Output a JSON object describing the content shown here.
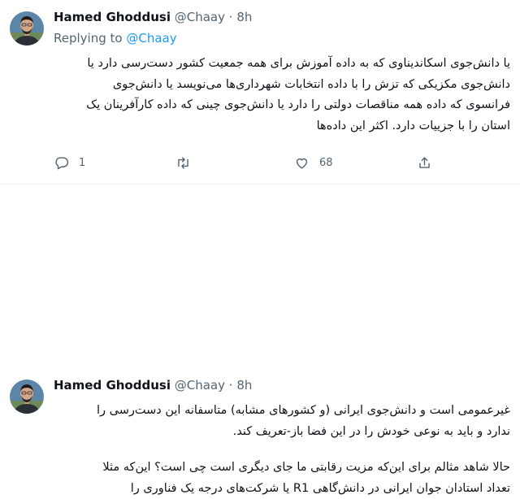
{
  "colors": {
    "accent": "#1d9bf0",
    "muted": "#536471",
    "text": "#0f1419"
  },
  "tweets": [
    {
      "author_name": "Hamed Ghoddusi",
      "handle": "@Chaay",
      "separator": "·",
      "time": "8h",
      "replying_to_label": "Replying to",
      "replying_to_handle": "@Chaay",
      "lines": [
        "یا دانش‌جوی اسکاندیناوی که به داده آموزش برای همه جمعیت کشور دست‌رسی دارد یا",
        "دانش‌جوی مکزیکی که تزش را با داده انتخابات شهرداری‌ها می‌نویسد یا دانش‌جوی",
        "فرانسوی که داده همه مناقصات دولتی را دارد یا دانش‌جوی چینی که داده کارآفرینان یک",
        "استان را با جزییات دارد. اکثر این داده‌ها"
      ],
      "actions": {
        "reply": {
          "icon": "reply-icon",
          "count": "1"
        },
        "retweet": {
          "icon": "retweet-icon",
          "count": ""
        },
        "like": {
          "icon": "heart-icon",
          "count": "68"
        },
        "share": {
          "icon": "share-icon",
          "count": ""
        }
      }
    },
    {
      "author_name": "Hamed Ghoddusi",
      "handle": "@Chaay",
      "separator": "·",
      "time": "8h",
      "lines": [
        "غیرعمومی است و دانش‌جوی ایرانی (و کشورهای مشابه) متاسفانه این دست‌رسی را",
        "ندارد و باید به نوعی خودش را در این فضا باز-تعریف کند."
      ],
      "lines2": [
        "حالا شاهد مثالم برای این‌که مزیت رقابتی ما جای دیگری است چی است؟ این‌که مثلا",
        "تعداد استادان جوان ایرانی در دانش‌گاهی R1 یا شرکت‌های درجه یک فناوری را"
      ]
    }
  ]
}
